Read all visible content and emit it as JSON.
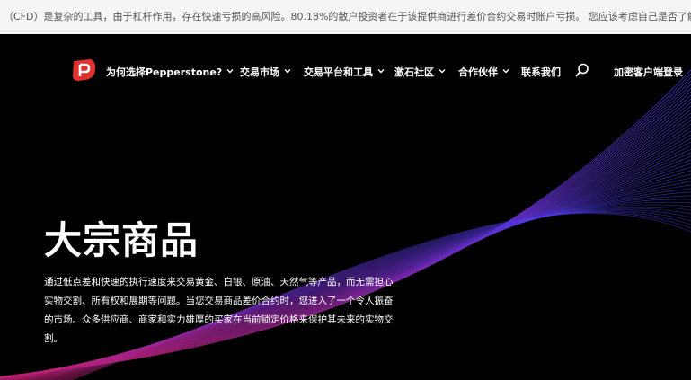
{
  "risk_warning": {
    "text": "（CFD）是复杂的工具，由于杠杆作用，存在快速亏损的高风险。80.18%的散户投资者在于该提供商进行差价合约交易时账户亏损。 您应该考虑自己是否了解差价合约的运作方式"
  },
  "nav": {
    "items": [
      {
        "label": "为何选择Pepperstone?",
        "dropdown": true
      },
      {
        "label": "交易市场",
        "dropdown": true
      },
      {
        "label": "交易平台和工具",
        "dropdown": true
      },
      {
        "label": "激石社区",
        "dropdown": true
      },
      {
        "label": "合作伙伴",
        "dropdown": true
      },
      {
        "label": "联系我们",
        "dropdown": false
      }
    ],
    "login_label": "加密客户端登录"
  },
  "hero": {
    "title": "大宗商品",
    "description": "通过低点差和快速的执行速度来交易黄金、白银、原油、天然气等产品，而无需担心实物交割、所有权和展期等问题。当您交易商品差价合约时，您进入了一个令人振奋的市场。众多供应商、商家和实力雄厚的买家在当前锁定价格来保护其未来的实物交割。"
  },
  "colors": {
    "logo": "#e0312f",
    "background": "#000000",
    "wave_start": "#3b2fd9",
    "wave_end": "#d1206e"
  }
}
